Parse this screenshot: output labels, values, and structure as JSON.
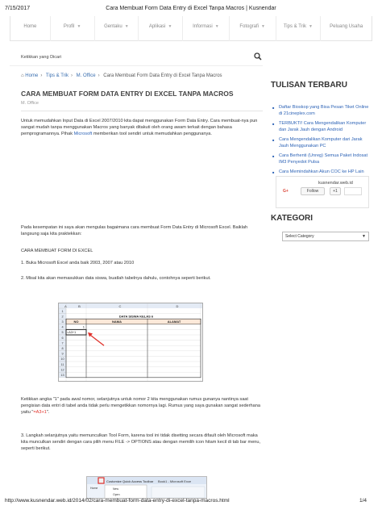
{
  "print": {
    "date": "7/15/2017",
    "title": "Cara Membuat Form Data Entry di Excel Tanpa Macros | Kusnendar",
    "url": "http://www.kusnendar.web.id/2014/02/cara-membuat-form-data-entry-di-excel-tanpa-macros.html",
    "page": "1/4"
  },
  "nav": {
    "items": [
      {
        "label": "Home",
        "caret": false
      },
      {
        "label": "Profil",
        "caret": true
      },
      {
        "label": "Gentaku",
        "caret": true
      },
      {
        "label": "Aplikasi",
        "caret": true
      },
      {
        "label": "Informasi",
        "caret": true
      },
      {
        "label": "Fotografi",
        "caret": true
      },
      {
        "label": "Tips & Trik",
        "caret": true
      },
      {
        "label": "Peluang Usaha",
        "caret": false
      }
    ]
  },
  "search": {
    "placeholder": "Ketikkan yang Dicari"
  },
  "breadcrumb": {
    "home": "Home",
    "tips": "Tips & Trik",
    "office": "M. Office",
    "current": "Cara Membuat Form Data Entry di Excel Tanpa Macros"
  },
  "post": {
    "title": "CARA MEMBUAT FORM DATA ENTRY DI EXCEL TANPA MACROS",
    "category": "M. Office",
    "intro_a": "Untuk memudahkan Input Data di Excel 2007/2010 kita dapat menggunakan Form Data Entry. Cara membuat-nya pun sangat mudah tanpa menggunakan Macros yang banyak ditakuti oleh orang awam terkait dengan bahasa pemprogramannya.  Pihak ",
    "intro_link": "Microsoft",
    "intro_b": " memberikan tool sendiri untuk memudahkan penggunanya.",
    "p2": "Pada kesempatan ini saya akan mengulas bagaimana cara membuat Form Data Entry di Microsoft Excel.  Baiklah langsung saja kita praktekkan:",
    "heading": "CARA MEMBUAT FORM DI EXCEL",
    "step1": "1. Buka Microsoft Excel anda baik 2003, 2007 atau 2010",
    "step2": "2. Misal kita akan memasukkan data siswa, buatlah tabelnya dahulu, contohnya seperti berikut.",
    "step2b_a": "Ketikkan angka \"1\" pada awal nomor, selanjutnya untuk nomor 2 kita menggunakan rumus gunanya nantinya saat pengisian data entri di tabel anda tidak perlu mengetikkan nomornya lagi.  Rumus yang saya gunakan sangat sederhana yaitu \"",
    "step2b_formula": "=A3+1",
    "step2b_b": "\".",
    "step3": "3. Langkah selanjutnya yaitu memunculkan Tool Form, karena tool ini tidak disetting secara difault oleh Microsoft maka kita munculkan sendiri dengan cara pilih menu FILE -> OPTIONS atau dengan memilih icon hitam kecil di tab bar menu, seperti berikut."
  },
  "spreadsheet": {
    "columns": [
      "A",
      "B",
      "C",
      "D"
    ],
    "table_title": "DATA SISWA KELAS 6",
    "headers": [
      "NO",
      "NAMA",
      "ALAMAT"
    ],
    "row_numbers": [
      "1",
      "2",
      "3",
      "4",
      "5",
      "6",
      "7",
      "8",
      "9",
      "10",
      "11",
      "12",
      "13"
    ],
    "first_value": "1",
    "formula_cell": "=A3+1"
  },
  "ribbon": {
    "qat_label": "Customize Quick Access Toolbar",
    "menu_items": [
      "New",
      "Open"
    ],
    "tab_home": "Home",
    "doc_title": "Book1 - Microsoft Exce"
  },
  "sidebar": {
    "recent_title": "TULISAN TERBARU",
    "recent": [
      "Daftar Bioskop yang Bisa Pesan Tiket Online di 21cineplex.com",
      "TERBUKTI! Cara Mengendalikan Komputer dan Jarak Jauh dengan Android",
      "Cara Mengendalikan Komputer dari Jarak Jauh Menggunakan PC",
      "Cara Berhenti (Unreg) Semua Paket Indosat IM3 Penyedot Pulsa",
      "Cara Memindahkan Akun COC ke HP Lain Sesama Android"
    ],
    "profile_name": "kusnendar.web.id",
    "gplus": "G+",
    "follow": "Follow",
    "plus_one": "+1",
    "category_title": "KATEGORI",
    "category_select": "Select Category"
  },
  "colors": {
    "link": "#2d63b6",
    "accent_red": "#e0312a",
    "excel_header_fill": "#fde9d9"
  }
}
